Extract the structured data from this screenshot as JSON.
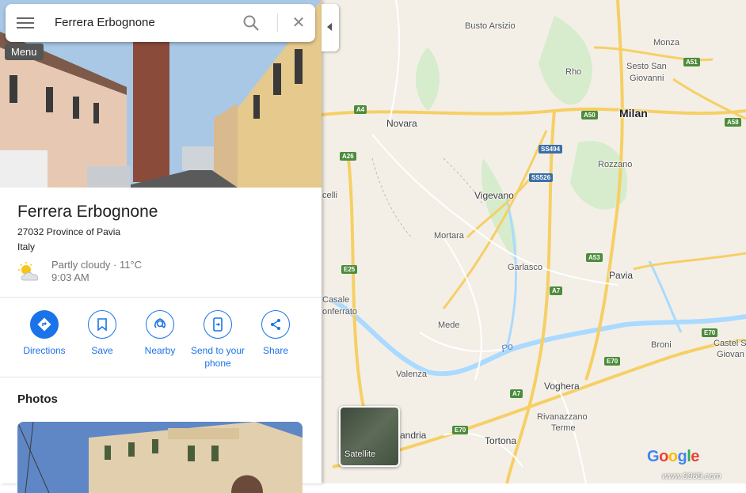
{
  "search": {
    "query": "Ferrera Erbognone",
    "menu_tooltip": "Menu"
  },
  "place": {
    "name": "Ferrera Erbognone",
    "address_line1": "27032 Province of Pavia",
    "address_line2": "Italy",
    "weather": {
      "condition": "Partly cloudy · 11°C",
      "time": "9:03 AM"
    }
  },
  "actions": [
    {
      "label": "Directions",
      "icon": "directions-icon"
    },
    {
      "label": "Save",
      "icon": "bookmark-icon"
    },
    {
      "label": "Nearby",
      "icon": "nearby-icon"
    },
    {
      "label": "Send to your phone",
      "icon": "send-to-phone-icon"
    },
    {
      "label": "Share",
      "icon": "share-icon"
    }
  ],
  "photos": {
    "title": "Photos"
  },
  "map": {
    "cities": [
      "Busto Arsizio",
      "Monza",
      "Sesto San",
      "Giovanni",
      "Rho",
      "Milan",
      "Novara",
      "Rozzano",
      "Vigevano",
      "Mortara",
      "Garlasco",
      "Pavia",
      "Casale",
      "onferrato",
      "Mede",
      "Broni",
      "Castel S",
      "Giovan",
      "Valenza",
      "Voghera",
      "Rivanazzano",
      "Terme",
      "andria",
      "Tortona",
      "celli"
    ],
    "roads": [
      "A4",
      "A51",
      "A50",
      "A58",
      "A26",
      "SS494",
      "SS526",
      "A53",
      "A7",
      "E25",
      "E70",
      "E70",
      "A7",
      "E70"
    ],
    "river": "Po",
    "layer_button": "Satellite",
    "logo": "Google",
    "watermark": "www.9969.com"
  },
  "colors": {
    "accent": "#1a73e8",
    "pin": "#e53935",
    "highway": "#f6cf65",
    "water": "#aadaff",
    "park": "#c6e6be"
  }
}
